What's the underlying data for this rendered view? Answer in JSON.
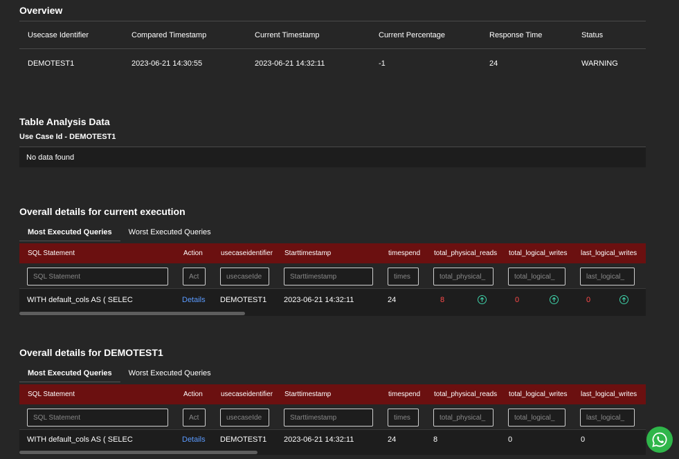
{
  "overview": {
    "title": "Overview",
    "headers": [
      "Usecase Identifier",
      "Compared Timestamp",
      "Current Timestamp",
      "Current Percentage",
      "Response Time",
      "Status"
    ],
    "row": [
      "DEMOTEST1",
      "2023-06-21 14:30:55",
      "2023-06-21 14:32:11",
      "-1",
      "24",
      "WARNING"
    ]
  },
  "table_analysis": {
    "title": "Table Analysis Data",
    "subtitle": "Use Case Id - DEMOTEST1",
    "empty_text": "No data found"
  },
  "current_exec": {
    "title": "Overall details for current execution",
    "tabs": [
      "Most Executed Queries",
      "Worst Executed Queries"
    ],
    "headers": [
      "SQL Statement",
      "Action",
      "usecaseidentifier",
      "Starttimestamp",
      "timespend",
      "total_physical_reads",
      "total_logical_writes",
      "last_logical_writes"
    ],
    "placeholders": [
      "SQL Statement",
      "Act",
      "usecaseIde",
      "Starttimestamp",
      "times",
      "total_physical_",
      "total_logical_",
      "last_logical_"
    ],
    "row": {
      "sql": "WITH default_cols AS ( SELEC",
      "action": "Details",
      "usecase": "DEMOTEST1",
      "start": "2023-06-21 14:32:11",
      "timespend": "24",
      "physical_reads": "8",
      "logical_writes": "0",
      "last_logical_writes": "0"
    },
    "scroll_fraction": 0.36
  },
  "demotest_exec": {
    "title": "Overall details for DEMOTEST1",
    "tabs": [
      "Most Executed Queries",
      "Worst Executed Queries"
    ],
    "headers": [
      "SQL Statement",
      "Action",
      "usecaseidentifier",
      "Starttimestamp",
      "timespend",
      "total_physical_reads",
      "total_logical_writes",
      "last_logical_writes"
    ],
    "placeholders": [
      "SQL Statement",
      "Act",
      "usecaseIde",
      "Starttimestamp",
      "times",
      "total_physical_",
      "total_logical_",
      "last_logical_"
    ],
    "row": {
      "sql": "WITH default_cols AS ( SELEC",
      "action": "Details",
      "usecase": "DEMOTEST1",
      "start": "2023-06-21 14:32:11",
      "timespend": "24",
      "physical_reads": "8",
      "logical_writes": "0",
      "last_logical_writes": "0"
    },
    "scroll_fraction": 0.38
  },
  "colors": {
    "header_bg": "#6b1010",
    "accent_link": "#5b9bff",
    "danger": "#ff4a4a",
    "up_arrow": "#3fd0a8",
    "whatsapp": "#2fb64a"
  },
  "icons": {
    "trend": "arrow-up-circle-icon",
    "chat": "whatsapp-icon"
  }
}
